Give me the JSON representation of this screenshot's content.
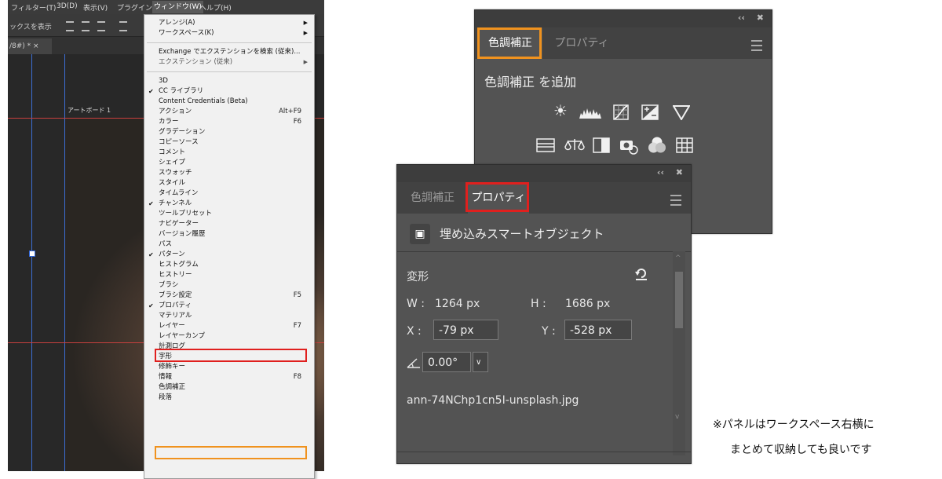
{
  "menubar": {
    "items": [
      "フィルター(T)",
      "3D(D)",
      "表示(V)",
      "プラグイン",
      "ウィンドウ(W)",
      "ヘルプ(H)"
    ],
    "active": "ウィンドウ(W)"
  },
  "options_bar": {
    "show_transform_label": "ックスを表示"
  },
  "document": {
    "tab_label": "/8#) * ×",
    "artboard_label": "アートボード 1"
  },
  "window_menu": {
    "items": [
      {
        "label": "アレンジ(A)",
        "submenu": true
      },
      {
        "label": "ワークスペース(K)",
        "submenu": true
      },
      {
        "label": "Exchange でエクステンションを検索 (従来)..."
      },
      {
        "label": "エクステンション (従来)",
        "submenu": true,
        "disabled": true
      },
      {
        "label": "3D"
      },
      {
        "label": "CC ライブラリ",
        "checked": true
      },
      {
        "label": "Content Credentials (Beta)"
      },
      {
        "label": "アクション",
        "shortcut": "Alt+F9"
      },
      {
        "label": "カラー",
        "shortcut": "F6"
      },
      {
        "label": "グラデーション"
      },
      {
        "label": "コピーソース"
      },
      {
        "label": "コメント"
      },
      {
        "label": "シェイプ"
      },
      {
        "label": "スウォッチ"
      },
      {
        "label": "スタイル"
      },
      {
        "label": "タイムライン"
      },
      {
        "label": "チャンネル",
        "checked": true
      },
      {
        "label": "ツールプリセット"
      },
      {
        "label": "ナビゲーター"
      },
      {
        "label": "バージョン履歴"
      },
      {
        "label": "パス"
      },
      {
        "label": "パターン",
        "checked": true
      },
      {
        "label": "ヒストグラム"
      },
      {
        "label": "ヒストリー"
      },
      {
        "label": "ブラシ"
      },
      {
        "label": "ブラシ設定",
        "shortcut": "F5"
      },
      {
        "label": "プロパティ",
        "checked": true
      },
      {
        "label": "マテリアル"
      },
      {
        "label": "レイヤー",
        "shortcut": "F7"
      },
      {
        "label": "レイヤーカンプ"
      },
      {
        "label": "計測ログ"
      },
      {
        "label": "字形"
      },
      {
        "label": "修飾キー"
      },
      {
        "label": "情報",
        "shortcut": "F8"
      },
      {
        "label": "色調補正"
      },
      {
        "label": "段落"
      }
    ]
  },
  "adjustments_panel": {
    "tabs": [
      "色調補正",
      "プロパティ"
    ],
    "active_tab": "色調補正",
    "title": "色調補正 を追加",
    "icons_row1": [
      "brightness-contrast-icon",
      "levels-icon",
      "curves-icon",
      "exposure-icon",
      "vibrance-icon"
    ],
    "icons_row2": [
      "hue-saturation-icon",
      "color-balance-icon",
      "black-white-icon",
      "photo-filter-icon",
      "channel-mixer-icon",
      "color-lookup-icon"
    ]
  },
  "properties_panel": {
    "tabs": [
      "色調補正",
      "プロパティ"
    ],
    "active_tab": "プロパティ",
    "smart_object_label": "埋め込みスマートオブジェクト",
    "transform_label": "変形",
    "w_label": "W :",
    "w_value": "1264 px",
    "h_label": "H :",
    "h_value": "1686 px",
    "x_label": "X :",
    "x_value": "-79 px",
    "y_label": "Y :",
    "y_value": "-528 px",
    "angle_value": "0.00°",
    "filename": "ann-74NChp1cn5I-unsplash.jpg"
  },
  "panel_header": {
    "collapse": "‹‹",
    "close": "✖"
  },
  "note": {
    "line1": "※パネルはワークスペース右横に",
    "line2": "まとめて収納しても良いです"
  },
  "colors": {
    "highlight_red": "#e0201e",
    "highlight_orange": "#f0921e"
  }
}
